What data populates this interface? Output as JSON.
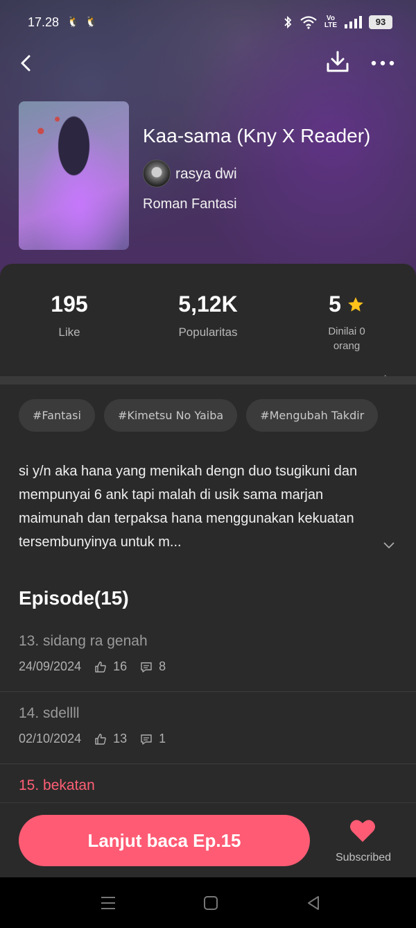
{
  "status_bar": {
    "time": "17.28",
    "battery": "93",
    "volte": "Vo\nLTE"
  },
  "book": {
    "title": "Kaa-sama (Kny X Reader)",
    "author": "rasya dwi",
    "genre": "Roman Fantasi"
  },
  "stats": {
    "likes_value": "195",
    "likes_label": "Like",
    "popularity_value": "5,12K",
    "popularity_label": "Popularitas",
    "rating_value": "5",
    "rating_label": "Dinilai 0 orang"
  },
  "tags": [
    "#Fantasi",
    "#Kimetsu No Yaiba",
    "#Mengubah Takdir"
  ],
  "description": "si y/n aka hana yang menikah dengn duo tsugikuni dan mempunyai 6 ank tapi malah di usik sama marjan maimunah dan terpaksa hana menggunakan kekuatan tersembunyinya untuk m...",
  "episodes_heading": "Episode(15)",
  "episodes": [
    {
      "title": "13. sidang ra genah",
      "date": "24/09/2024",
      "likes": "16",
      "comments": "8"
    },
    {
      "title": "14. sdellll",
      "date": "02/10/2024",
      "likes": "13",
      "comments": "1"
    },
    {
      "title": "15. bekatan"
    }
  ],
  "actions": {
    "read_button": "Lanjut baca Ep.15",
    "subscribed_label": "Subscribed"
  },
  "colors": {
    "accent": "#ff5b74",
    "star": "#ffc21a",
    "panel": "#2a2a2a"
  }
}
